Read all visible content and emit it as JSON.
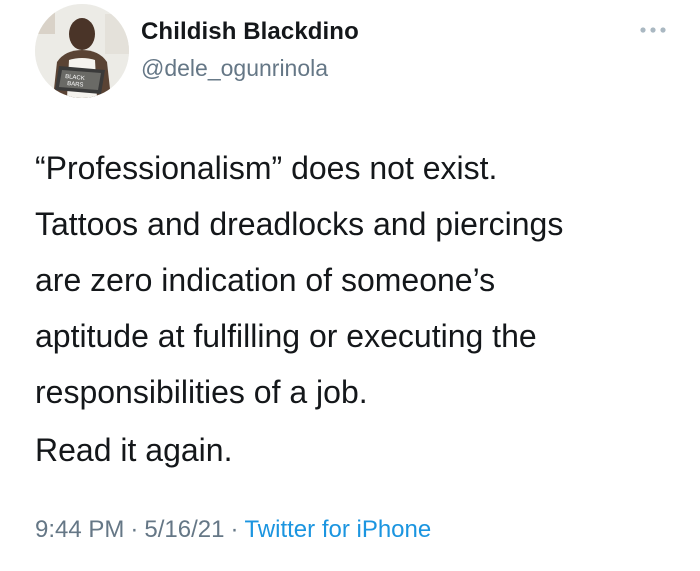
{
  "author": {
    "display_name": "Childish Blackdino",
    "handle": "@dele_ogunrinola"
  },
  "tweet": {
    "lines": [
      "“Professionalism” does not exist.",
      "Tattoos and dreadlocks and piercings",
      "are zero indication of someone’s",
      "aptitude at fulfilling or executing the",
      "responsibilities of a job."
    ],
    "second_paragraph": "Read it again."
  },
  "meta": {
    "time": "9:44 PM",
    "separator": "·",
    "date": "5/16/21",
    "source": "Twitter for iPhone"
  },
  "icons": {
    "more": "more-icon",
    "avatar": "avatar"
  },
  "colors": {
    "text": "#14171a",
    "secondary": "#657786",
    "link": "#1b95e0"
  }
}
